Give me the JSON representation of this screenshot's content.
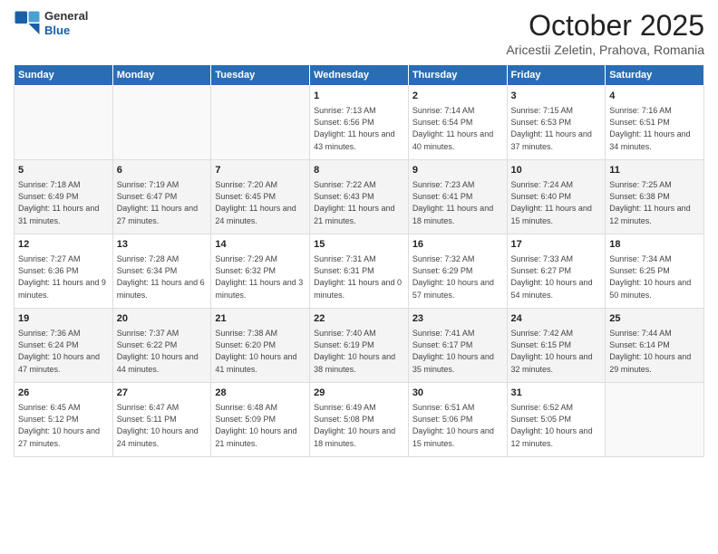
{
  "header": {
    "logo_line1": "General",
    "logo_line2": "Blue",
    "month": "October 2025",
    "location": "Aricestii Zeletin, Prahova, Romania"
  },
  "weekdays": [
    "Sunday",
    "Monday",
    "Tuesday",
    "Wednesday",
    "Thursday",
    "Friday",
    "Saturday"
  ],
  "weeks": [
    [
      {
        "day": "",
        "info": ""
      },
      {
        "day": "",
        "info": ""
      },
      {
        "day": "",
        "info": ""
      },
      {
        "day": "1",
        "info": "Sunrise: 7:13 AM\nSunset: 6:56 PM\nDaylight: 11 hours and 43 minutes."
      },
      {
        "day": "2",
        "info": "Sunrise: 7:14 AM\nSunset: 6:54 PM\nDaylight: 11 hours and 40 minutes."
      },
      {
        "day": "3",
        "info": "Sunrise: 7:15 AM\nSunset: 6:53 PM\nDaylight: 11 hours and 37 minutes."
      },
      {
        "day": "4",
        "info": "Sunrise: 7:16 AM\nSunset: 6:51 PM\nDaylight: 11 hours and 34 minutes."
      }
    ],
    [
      {
        "day": "5",
        "info": "Sunrise: 7:18 AM\nSunset: 6:49 PM\nDaylight: 11 hours and 31 minutes."
      },
      {
        "day": "6",
        "info": "Sunrise: 7:19 AM\nSunset: 6:47 PM\nDaylight: 11 hours and 27 minutes."
      },
      {
        "day": "7",
        "info": "Sunrise: 7:20 AM\nSunset: 6:45 PM\nDaylight: 11 hours and 24 minutes."
      },
      {
        "day": "8",
        "info": "Sunrise: 7:22 AM\nSunset: 6:43 PM\nDaylight: 11 hours and 21 minutes."
      },
      {
        "day": "9",
        "info": "Sunrise: 7:23 AM\nSunset: 6:41 PM\nDaylight: 11 hours and 18 minutes."
      },
      {
        "day": "10",
        "info": "Sunrise: 7:24 AM\nSunset: 6:40 PM\nDaylight: 11 hours and 15 minutes."
      },
      {
        "day": "11",
        "info": "Sunrise: 7:25 AM\nSunset: 6:38 PM\nDaylight: 11 hours and 12 minutes."
      }
    ],
    [
      {
        "day": "12",
        "info": "Sunrise: 7:27 AM\nSunset: 6:36 PM\nDaylight: 11 hours and 9 minutes."
      },
      {
        "day": "13",
        "info": "Sunrise: 7:28 AM\nSunset: 6:34 PM\nDaylight: 11 hours and 6 minutes."
      },
      {
        "day": "14",
        "info": "Sunrise: 7:29 AM\nSunset: 6:32 PM\nDaylight: 11 hours and 3 minutes."
      },
      {
        "day": "15",
        "info": "Sunrise: 7:31 AM\nSunset: 6:31 PM\nDaylight: 11 hours and 0 minutes."
      },
      {
        "day": "16",
        "info": "Sunrise: 7:32 AM\nSunset: 6:29 PM\nDaylight: 10 hours and 57 minutes."
      },
      {
        "day": "17",
        "info": "Sunrise: 7:33 AM\nSunset: 6:27 PM\nDaylight: 10 hours and 54 minutes."
      },
      {
        "day": "18",
        "info": "Sunrise: 7:34 AM\nSunset: 6:25 PM\nDaylight: 10 hours and 50 minutes."
      }
    ],
    [
      {
        "day": "19",
        "info": "Sunrise: 7:36 AM\nSunset: 6:24 PM\nDaylight: 10 hours and 47 minutes."
      },
      {
        "day": "20",
        "info": "Sunrise: 7:37 AM\nSunset: 6:22 PM\nDaylight: 10 hours and 44 minutes."
      },
      {
        "day": "21",
        "info": "Sunrise: 7:38 AM\nSunset: 6:20 PM\nDaylight: 10 hours and 41 minutes."
      },
      {
        "day": "22",
        "info": "Sunrise: 7:40 AM\nSunset: 6:19 PM\nDaylight: 10 hours and 38 minutes."
      },
      {
        "day": "23",
        "info": "Sunrise: 7:41 AM\nSunset: 6:17 PM\nDaylight: 10 hours and 35 minutes."
      },
      {
        "day": "24",
        "info": "Sunrise: 7:42 AM\nSunset: 6:15 PM\nDaylight: 10 hours and 32 minutes."
      },
      {
        "day": "25",
        "info": "Sunrise: 7:44 AM\nSunset: 6:14 PM\nDaylight: 10 hours and 29 minutes."
      }
    ],
    [
      {
        "day": "26",
        "info": "Sunrise: 6:45 AM\nSunset: 5:12 PM\nDaylight: 10 hours and 27 minutes."
      },
      {
        "day": "27",
        "info": "Sunrise: 6:47 AM\nSunset: 5:11 PM\nDaylight: 10 hours and 24 minutes."
      },
      {
        "day": "28",
        "info": "Sunrise: 6:48 AM\nSunset: 5:09 PM\nDaylight: 10 hours and 21 minutes."
      },
      {
        "day": "29",
        "info": "Sunrise: 6:49 AM\nSunset: 5:08 PM\nDaylight: 10 hours and 18 minutes."
      },
      {
        "day": "30",
        "info": "Sunrise: 6:51 AM\nSunset: 5:06 PM\nDaylight: 10 hours and 15 minutes."
      },
      {
        "day": "31",
        "info": "Sunrise: 6:52 AM\nSunset: 5:05 PM\nDaylight: 10 hours and 12 minutes."
      },
      {
        "day": "",
        "info": ""
      }
    ]
  ]
}
